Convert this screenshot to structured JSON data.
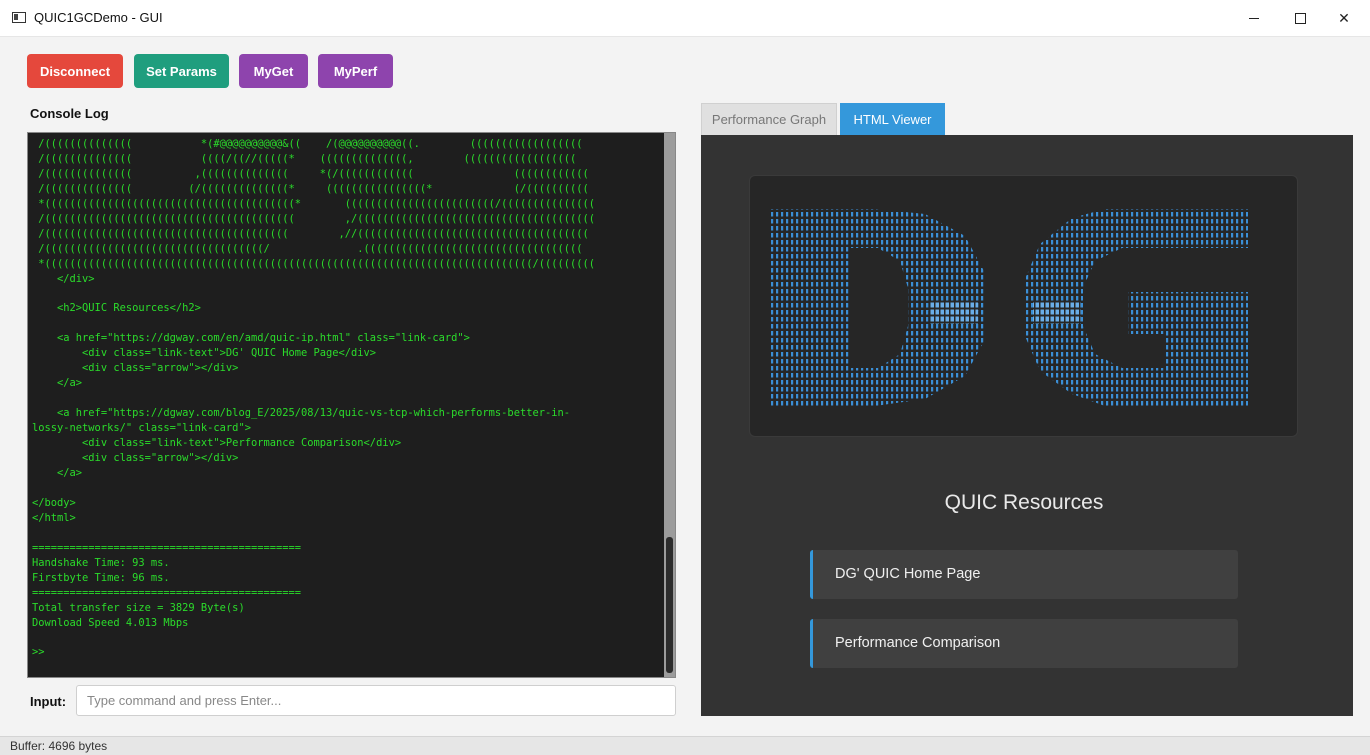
{
  "window": {
    "title": "QUIC1GCDemo - GUI"
  },
  "toolbar": {
    "disconnect_label": "Disconnect",
    "set_params_label": "Set Params",
    "myget_label": "MyGet",
    "myperf_label": "MyPerf"
  },
  "console": {
    "label": "Console Log",
    "lines": [
      " /((((((((((((((           *(#@@@@@@@@@@&((    /(@@@@@@@@@@((.        ((((((((((((((((((",
      " /((((((((((((((           ((((/((//(((((*    ((((((((((((((,        ((((((((((((((((((",
      " /((((((((((((((          ,((((((((((((((     *(/((((((((((((                ((((((((((((",
      " /((((((((((((((         (/((((((((((((((*     ((((((((((((((((*             (/((((((((((",
      " *((((((((((((((((((((((((((((((((((((((((*       ((((((((((((((((((((((((/(((((((((((((((",
      " /((((((((((((((((((((((((((((((((((((((((        ,/((((((((((((((((((((((((((((((((((((((",
      " /(((((((((((((((((((((((((((((((((((((((        ,//(((((((((((((((((((((((((((((((((((((",
      " /(((((((((((((((((((((((((((((((((((/              .(((((((((((((((((((((((((((((((((((",
      " *((((((((((((((((((((((((((((((((((((((((((((((((((((((((((((((((((((((((((((((/(((((((((",
      "    </div>",
      "",
      "    <h2>QUIC Resources</h2>",
      "",
      "    <a href=\"https://dgway.com/en/amd/quic-ip.html\" class=\"link-card\">",
      "        <div class=\"link-text\">DG' QUIC Home Page</div>",
      "        <div class=\"arrow\"></div>",
      "    </a>",
      "",
      "    <a href=\"https://dgway.com/blog_E/2025/08/13/quic-vs-tcp-which-performs-better-in-",
      "lossy-networks/\" class=\"link-card\">",
      "        <div class=\"link-text\">Performance Comparison</div>",
      "        <div class=\"arrow\"></div>",
      "    </a>",
      "",
      "</body>",
      "</html>",
      "",
      "===========================================",
      "Handshake Time: 93 ms.",
      "Firstbyte Time: 96 ms.",
      "===========================================",
      "Total transfer size = 3829 Byte(s)",
      "Download Speed 4.013 Mbps",
      "",
      ">>"
    ]
  },
  "input": {
    "label": "Input:",
    "placeholder": "Type command and press Enter..."
  },
  "tabs": [
    {
      "label": "Performance Graph",
      "active": false
    },
    {
      "label": "HTML Viewer",
      "active": true
    }
  ],
  "viewer": {
    "heading": "QUIC Resources",
    "links": [
      {
        "text": "DG' QUIC Home Page"
      },
      {
        "text": "Performance Comparison"
      }
    ]
  },
  "status": {
    "text": "Buffer: 4696 bytes"
  },
  "colors": {
    "disconnect": "#e5483c",
    "set_params": "#1f9e7e",
    "purple": "#8e44ad",
    "active_tab": "#3498db",
    "console_text": "#2bdc2b",
    "logo_text": "#3b8fd6"
  }
}
